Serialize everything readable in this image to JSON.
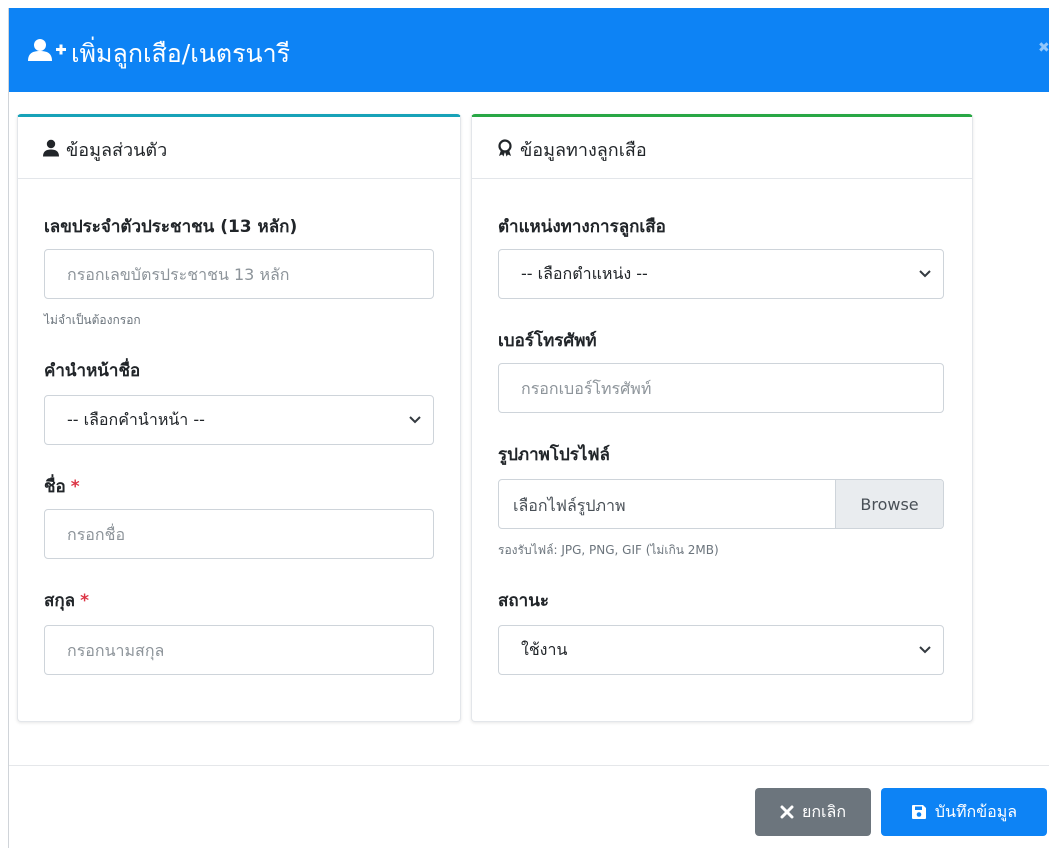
{
  "modal": {
    "title": "เพิ่มลูกเสือ/เนตรนารี",
    "title_icon": "user-plus-icon",
    "close_icon": "close-icon"
  },
  "personal": {
    "header": "ข้อมูลส่วนตัว",
    "icon": "user-icon",
    "citizen_id": {
      "label": "เลขประจำตัวประชาชน (13 หลัก)",
      "placeholder": "กรอกเลขบัตรประชาชน 13 หลัก",
      "value": "",
      "hint": "ไม่จำเป็นต้องกรอก"
    },
    "prefix": {
      "label": "คำนำหน้าชื่อ",
      "selected": "-- เลือกคำนำหน้า --"
    },
    "first_name": {
      "label": "ชื่อ",
      "required_mark": "*",
      "placeholder": "กรอกชื่อ",
      "value": ""
    },
    "last_name": {
      "label": "สกุล",
      "required_mark": "*",
      "placeholder": "กรอกนามสกุล",
      "value": ""
    }
  },
  "scout": {
    "header": "ข้อมูลทางลูกเสือ",
    "icon": "award-icon",
    "position": {
      "label": "ตำแหน่งทางการลูกเสือ",
      "selected": "-- เลือกตำแหน่ง --"
    },
    "phone": {
      "label": "เบอร์โทรศัพท์",
      "placeholder": "กรอกเบอร์โทรศัพท์",
      "value": ""
    },
    "photo": {
      "label": "รูปภาพโปรไฟล์",
      "file_text": "เลือกไฟล์รูปภาพ",
      "browse": "Browse",
      "hint": "รองรับไฟล์: JPG, PNG, GIF (ไม่เกิน 2MB)"
    },
    "status": {
      "label": "สถานะ",
      "selected": "ใช้งาน"
    }
  },
  "footer": {
    "cancel": "ยกเลิก",
    "cancel_icon": "times-icon",
    "save": "บันทึกข้อมูล",
    "save_icon": "save-icon"
  },
  "colors": {
    "header_bg": "#0d83f5",
    "personal_accent": "#17a2b8",
    "scout_accent": "#28a745",
    "cancel_bg": "#6c757d",
    "save_bg": "#0d83f5",
    "required": "#dc3545"
  }
}
